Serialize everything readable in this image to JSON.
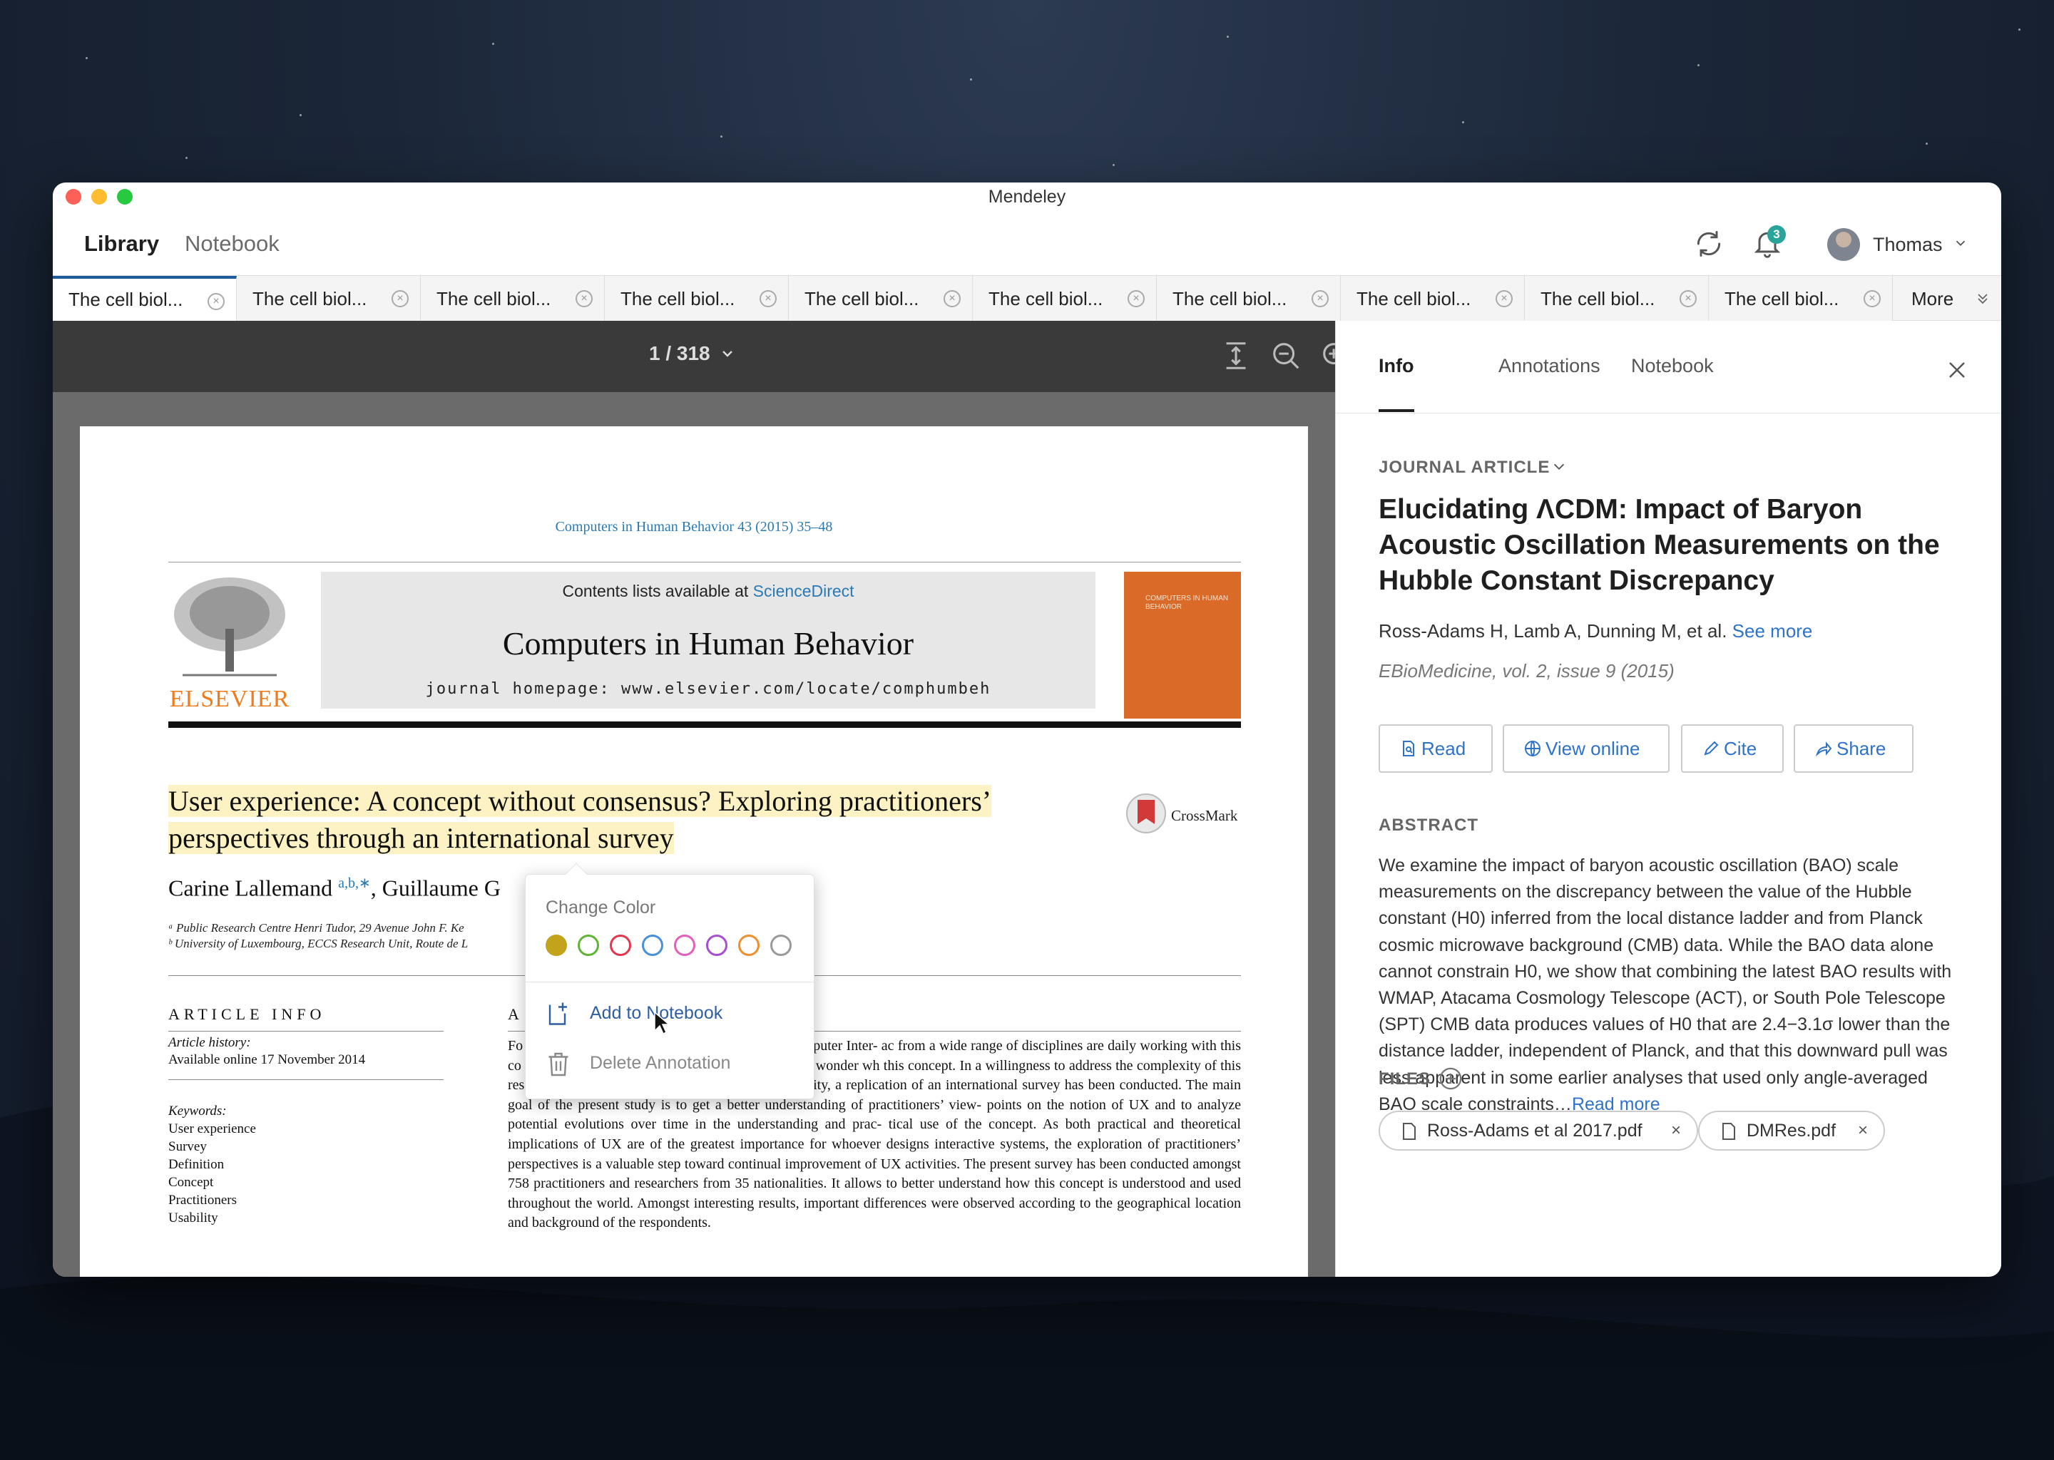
{
  "window": {
    "title": "Mendeley"
  },
  "nav": {
    "library": "Library",
    "notebook": "Notebook",
    "notification_count": "3",
    "user_name": "Thomas"
  },
  "tabs": {
    "items": [
      {
        "label": "The cell biol..."
      },
      {
        "label": "The cell biol..."
      },
      {
        "label": "The cell biol..."
      },
      {
        "label": "The cell biol..."
      },
      {
        "label": "The cell biol..."
      },
      {
        "label": "The cell biol..."
      },
      {
        "label": "The cell biol..."
      },
      {
        "label": "The cell biol..."
      },
      {
        "label": "The cell biol..."
      },
      {
        "label": "The cell biol..."
      }
    ],
    "more": "More"
  },
  "viewer": {
    "page_indicator": "1 / 318"
  },
  "pdf": {
    "journal_ref": "Computers in Human Behavior 43 (2015) 35–48",
    "contents_prefix": "Contents lists available at ",
    "contents_link": "ScienceDirect",
    "journal_title": "Computers in Human Behavior",
    "homepage": "journal homepage: www.elsevier.com/locate/comphumbeh",
    "publisher": "ELSEVIER",
    "cover_text": "COMPUTERS IN HUMAN BEHAVIOR",
    "title_line1": "User experience: A concept without consensus? Exploring practitioners’",
    "title_line2": "perspectives through an international survey",
    "crossmark": "CrossMark",
    "author1": "Carine Lallemand",
    "author1_sup": "a,b,∗",
    "author2": ", Guillaume G",
    "affil_a": "ᵃ Public Research Centre Henri Tudor, 29 Avenue John F. Ke",
    "affil_b": "ᵇ University of Luxembourg, ECCS Research Unit, Route de L",
    "article_info_head": "ARTICLE INFO",
    "abstract_head_partial": "A",
    "history_label": "Article history:",
    "history_value": "Available online 17 November 2014",
    "keywords_label": "Keywords:",
    "keywords": [
      "User experience",
      "Survey",
      "Definition",
      "Concept",
      "Practitioners",
      "Usability"
    ],
    "abstract_text": "Fo                                              X) has grown into a core concept of Human–Computer Inter- ac                                              from a wide range of disciplines are daily working with this co                                              to understand, define and scope UX, one may still wonder wh                                              this concept. In a willingness to address the complexity of this research topic and bring the concept of UX to maturity, a replication of an international survey has been conducted. The main goal of the present study is to get a better understanding of practitioners’ view- points on the notion of UX and to analyze potential evolutions over time in the understanding and prac- tical use of the concept. As both practical and theoretical implications of UX are of the greatest importance for whoever designs interactive systems, the exploration of practitioners’ perspectives is a valuable step toward continual improvement of UX activities. The present survey has been conducted amongst 758 practitioners and researchers from 35 nationalities. It allows to better understand how this concept is understood and used throughout the world. Amongst interesting results, important differences were observed according to the geographical location and background of the respondents."
  },
  "popup": {
    "heading": "Change Color",
    "colors": [
      "#c2a31a",
      "#5fb535",
      "#e4354d",
      "#4a90d9",
      "#e35fb8",
      "#a74fd0",
      "#ef8f2e",
      "#9a9a9a"
    ],
    "add_to_notebook": "Add to Notebook",
    "delete_annotation": "Delete Annotation"
  },
  "pane": {
    "tabs": [
      "Info",
      "Annotations",
      "Notebook"
    ],
    "doc_type": "JOURNAL ARTICLE",
    "title": "Elucidating ΛCDM: Impact of Baryon Acoustic Oscillation Measurements on the Hubble Constant Discrepancy",
    "authors": "Ross-Adams H, Lamb A, Dunning M, et al.",
    "see_more": "See more",
    "source": "EBioMedicine, vol. 2, issue 9 (2015)",
    "buttons": {
      "read": "Read",
      "view_online": "View online",
      "cite": "Cite",
      "share": "Share"
    },
    "abstract_head": "ABSTRACT",
    "abstract": "We examine the impact of baryon acoustic oscillation (BAO) scale measurements on the discrepancy between the value of the Hubble constant (H0) inferred from the local distance ladder and from Planck cosmic microwave background (CMB) data. While the BAO data alone cannot constrain H0, we show that combining the latest BAO results with WMAP, Atacama Cosmology Telescope (ACT), or South Pole Telescope (SPT) CMB data produces values of H0 that are 2.4−3.1σ lower than the distance ladder, independent of Planck, and that this downward pull was less apparent in some earlier analyses that used only angle-averaged BAO scale constraints…",
    "read_more": "Read more",
    "files_head": "FILES",
    "files": [
      "Ross-Adams et al 2017.pdf",
      "DMRes.pdf"
    ]
  }
}
